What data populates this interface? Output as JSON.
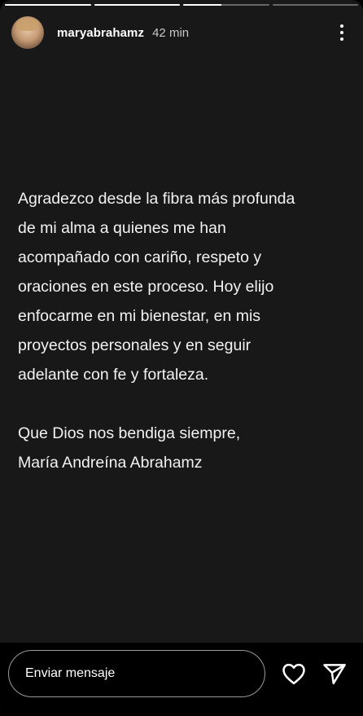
{
  "story": {
    "progress": [
      1,
      1,
      0.45,
      0
    ]
  },
  "header": {
    "username": "maryabrahamz",
    "time": "42 min",
    "avatar_icon": "profile-avatar",
    "more_icon": "more-vertical-icon"
  },
  "content": {
    "lines": [
      "Agradezco desde la fibra más profunda",
      "de mi alma a quienes me han",
      "acompañado con cariño, respeto y",
      "oraciones en este proceso. Hoy elijo",
      "enfocarme en mi bienestar, en mis",
      "proyectos personales y en seguir",
      "adelante con fe y fortaleza."
    ],
    "closing": [
      "Que Dios nos bendiga siempre,",
      "María Andreína Abrahamz"
    ]
  },
  "footer": {
    "reply_placeholder": "Enviar mensaje",
    "like_icon": "heart-icon",
    "send_icon": "send-icon"
  },
  "colors": {
    "background": "#181818",
    "text": "#f2f2f2",
    "bar": "#000000"
  }
}
